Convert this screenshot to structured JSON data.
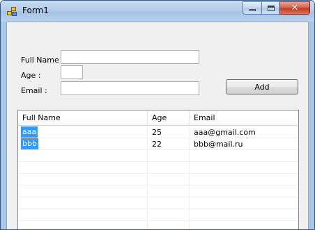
{
  "window": {
    "title": "Form1",
    "buttons": {
      "minimize": "",
      "maximize": "",
      "close": "✕"
    }
  },
  "form": {
    "full_name_label": "Full Name :",
    "age_label": "Age :",
    "email_label": "Email :",
    "full_name_value": "",
    "age_value": "",
    "email_value": "",
    "add_button": "Add"
  },
  "list": {
    "columns": [
      "Full Name",
      "Age",
      "Email"
    ],
    "rows": [
      {
        "full_name": "aaa",
        "age": "25",
        "email": "aaa@gmail.com",
        "selected": true
      },
      {
        "full_name": "bbb",
        "age": "22",
        "email": "bbb@mail.ru",
        "selected": true
      }
    ]
  },
  "colors": {
    "selection": "#3399ff",
    "client_background": "#f0f0f0",
    "title_bar": "#b5cde9",
    "close_button": "#c23d22"
  }
}
